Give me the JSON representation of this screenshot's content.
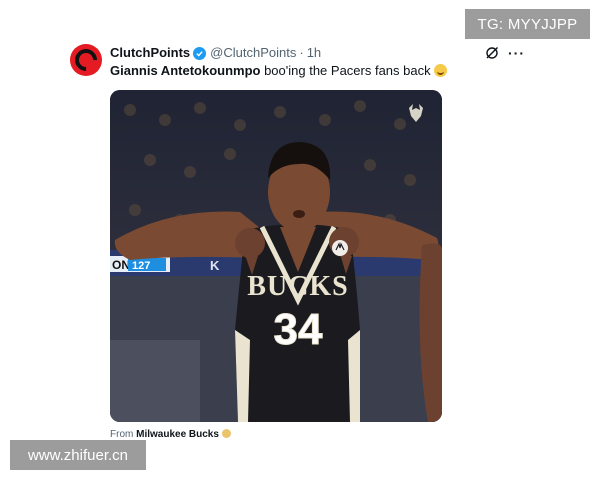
{
  "tweet": {
    "display_name": "ClutchPoints",
    "handle": "@ClutchPoints",
    "separator": "·",
    "time_ago": "1h",
    "text_mention": "Giannis Antetokounmpo",
    "text_body": " boo'ing the Pacers fans back",
    "emoji_name": "grinning-sweat-emoji",
    "more_label": "···"
  },
  "media": {
    "jersey_team": "BUCKS",
    "jersey_number": "34",
    "scoreboard_left": "ON",
    "scoreboard_value": "127",
    "scoreboard_right": "K"
  },
  "source": {
    "prefix": "From ",
    "name": "Milwaukee Bucks"
  },
  "watermarks": {
    "top_right": "TG: MYYJJPP",
    "bottom_left": "www.zhifuer.cn"
  },
  "colors": {
    "verified": "#1d9bf0",
    "clutchpoints_red": "#e51b24",
    "bucks_jersey": "#1b1b1f",
    "court_blue": "#2a3a6e"
  }
}
